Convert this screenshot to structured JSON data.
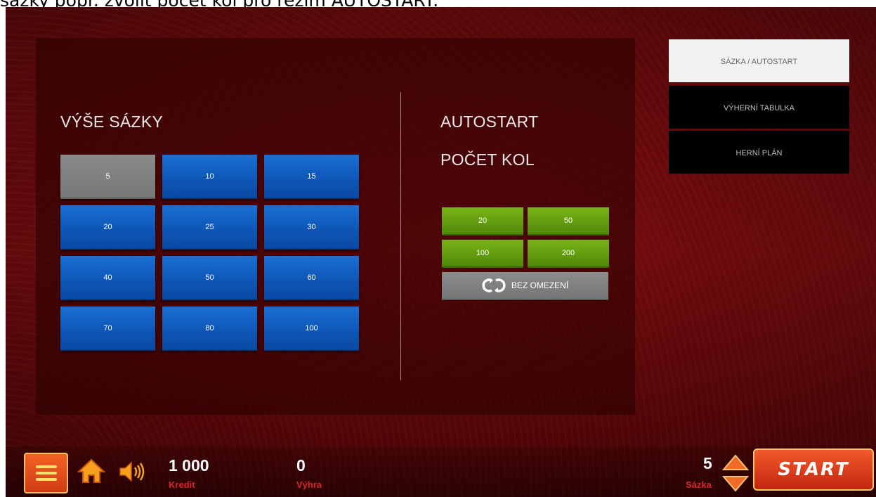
{
  "caption": "sázky popř. zvolit počet kol pro režim AUTOSTART.",
  "bet_panel": {
    "heading": "VÝŠE SÁZKY",
    "options": [
      "5",
      "10",
      "15",
      "20",
      "25",
      "30",
      "40",
      "50",
      "60",
      "70",
      "80",
      "100"
    ],
    "selected": "5"
  },
  "autostart_panel": {
    "heading": "AUTOSTART",
    "subheading": "POČET KOL",
    "rounds": [
      "20",
      "50",
      "100",
      "200"
    ],
    "unlimited_label": "BEZ OMEZENÍ"
  },
  "tabs": [
    {
      "label": "SÁZKA / AUTOSTART",
      "active": true
    },
    {
      "label": "VÝHERNÍ TABULKA",
      "active": false
    },
    {
      "label": "HERNÍ PLÁN",
      "active": false
    }
  ],
  "bottom_bar": {
    "credit_value": "1 000",
    "credit_label": "Kredit",
    "win_value": "0",
    "win_label": "Výhra",
    "bet_value": "5",
    "bet_label": "Sázka",
    "start_label": "START"
  },
  "icons": [
    "menu-icon",
    "home-icon",
    "speaker-icon",
    "refresh-icon",
    "arrow-up-icon",
    "arrow-down-icon"
  ],
  "colors": {
    "background": "#7e0d10",
    "bet_button": "#0d55b5",
    "bet_selected": "#7f7f7f",
    "round_button": "#5f9a0c",
    "accent_red": "#d8262b",
    "start_button": "#e04a1f"
  }
}
